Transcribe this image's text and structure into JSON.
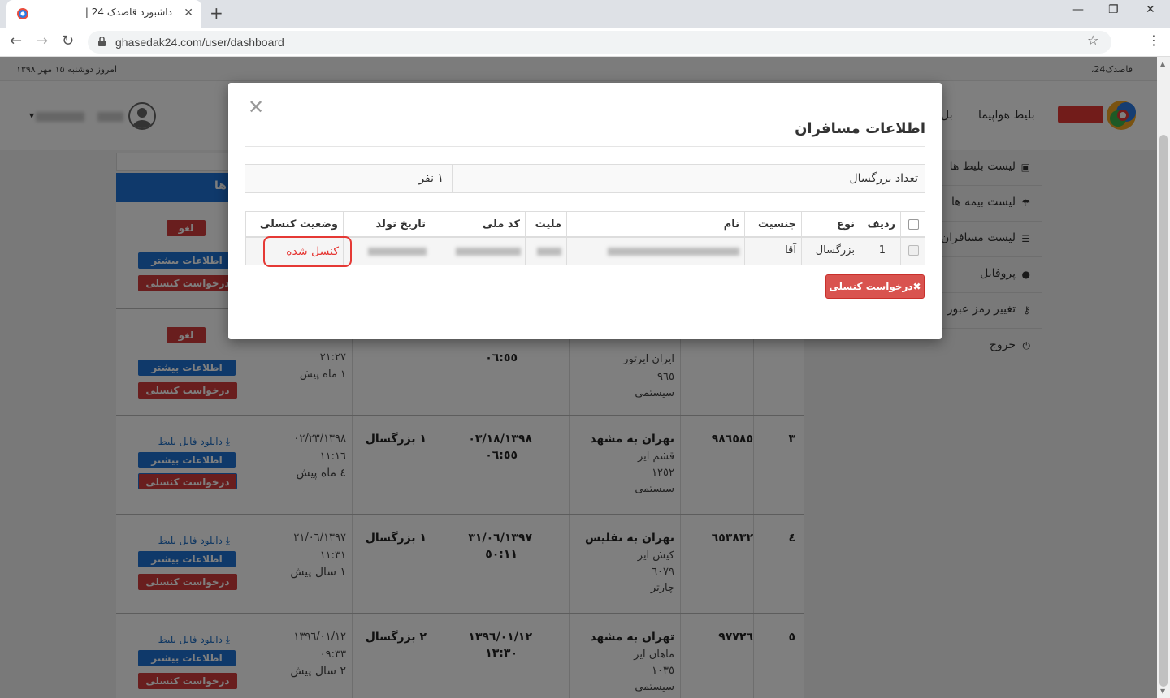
{
  "browser": {
    "tab_title": "داشبورد قاصدک 24 |",
    "url": "ghasedak24.com/user/dashboard"
  },
  "topstrip": {
    "date": "امروز دوشنبه ۱۵ مهر ۱۳۹۸",
    "brand": "قاصدک24،"
  },
  "header": {
    "nav_flight": "بلیط هواپیما",
    "nav_partial": "بل"
  },
  "sidebar": {
    "items": [
      {
        "label": "لیست بلیط ها",
        "icon": "bus-icon"
      },
      {
        "label": "لیست بیمه ها",
        "icon": "umbrella-icon"
      },
      {
        "label": "لیست مسافران",
        "icon": "list-icon"
      },
      {
        "label": "پروفایل",
        "icon": "user-icon"
      },
      {
        "label": "تغییر رمز عبور",
        "icon": "key-icon"
      },
      {
        "label": "خروج",
        "icon": "power-icon"
      }
    ]
  },
  "content": {
    "bar_title": "ها",
    "btn_more": "اطلاعات بیشتر",
    "btn_cancel_request": "درخواست کنسلی",
    "badge_cancelled": "لغو شده",
    "download": "دانلود فایل بلیط",
    "rows": [
      {
        "num": "",
        "code": "",
        "route": "",
        "airline": "",
        "flight": "",
        "system": "",
        "date": "",
        "time": "",
        "passengers": "",
        "book_date": "",
        "book_time": "",
        "ago": "",
        "cancelled": true
      },
      {
        "num": "",
        "code": "",
        "route": "",
        "airline": "ایران ایرتور",
        "flight": "۹٦٥",
        "system": "سیستمی",
        "date": "",
        "time": "٠٦:٥٥",
        "passengers": "",
        "book_date": "",
        "book_time": "۲۱:۲۷",
        "ago": "۱ ماه پیش",
        "cancelled": true
      },
      {
        "num": "۳",
        "code": "۹۸٦٥٨٥",
        "route": "تهران به مشهد",
        "airline": "قشم ایر",
        "flight": "۱۲٥۲",
        "system": "سیستمی",
        "date": "۱۳۹۸/٠۳/۱۸",
        "time": "٠٦:٥٥",
        "passengers": "۱ بزرگسال",
        "book_date": "۱۳۹۸/٠۲/۲۳",
        "book_time": "۱٦:۱۱",
        "ago": "٤ ماه پیش",
        "cancelled": false
      },
      {
        "num": "٤",
        "code": "٦٥۳۸۳۲",
        "route": "تهران به تفلیس",
        "airline": "کیش ایر",
        "flight": "٦٠۷۹",
        "system": "چارتر",
        "date": "۱۳۹۷/٠٦/۳۱",
        "time": "۱۱:٥٠",
        "passengers": "۱ بزرگسال",
        "book_date": "۱۳۹۷/٠٦/۲۱",
        "book_time": "۱۱:۳۱",
        "ago": "۱ سال پیش",
        "cancelled": false
      },
      {
        "num": "٥",
        "code": "۹۷۷۲٦",
        "route": "تهران به مشهد",
        "airline": "ماهان ایر",
        "flight": "۱٠۳٥",
        "system": "سیستمی",
        "date": "۱۳۹٦/٠۱/۱۲",
        "time": "۱۳:۳٠",
        "passengers": "۲ بزرگسال",
        "book_date": "۱۳۹٦/٠۱/۱۲",
        "book_time": "٠۹:۳۳",
        "ago": "۲ سال پیش",
        "cancelled": false
      }
    ]
  },
  "modal": {
    "title": "اطلاعات مسافران",
    "count_label": "تعداد بزرگسال",
    "count_value": "۱ نفر",
    "headers": {
      "row": "ردیف",
      "type": "نوع",
      "gender": "جنسیت",
      "name": "نام",
      "nationality": "ملیت",
      "national_code": "کد ملی",
      "birth_date": "تاریخ تولد",
      "cancel_status": "وضعیت کنسلی"
    },
    "passenger": {
      "row": "1",
      "type": "بزرگسال",
      "gender": "آقا",
      "cancel_status": "کنسل شده"
    },
    "cancel_button": "✖درخواست کنسلی"
  },
  "colors": {
    "accent_blue": "#1f72d6",
    "danger_red": "#d33c3c",
    "highlight_red": "#e53935"
  }
}
